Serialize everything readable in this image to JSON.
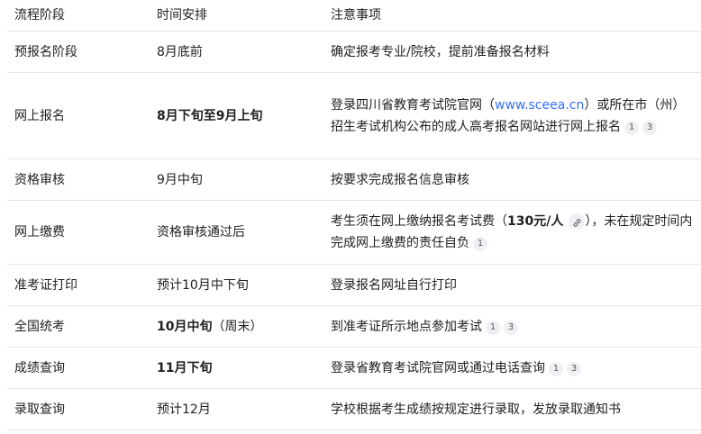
{
  "headers": [
    "流程阶段",
    "时间安排",
    "注意事项"
  ],
  "rows": [
    {
      "stage": "预报名阶段",
      "time": "8月底前",
      "note": "确定报考专业/院校，提前准备报名材料"
    },
    {
      "stage": "网上报名",
      "time": "8月下旬至9月上旬",
      "note_pre": "登录四川省教育考试院官网（",
      "note_link": "www.sceea.cn",
      "note_post": "）或所在市（州）招生考试机构公布的成人高考报名网站进行网上报名",
      "refs": [
        "1",
        "3"
      ]
    },
    {
      "stage": "资格审核",
      "time": "9月中旬",
      "note": "按要求完成报名信息审核"
    },
    {
      "stage": "网上缴费",
      "time": "资格审核通过后",
      "note_pre": "考生须在网上缴纳报名考试费（",
      "note_bold": "130元/人",
      "note_post": "），未在规定时间内完成网上缴费的责任自负",
      "refs": [
        "1"
      ]
    },
    {
      "stage": "准考证打印",
      "time": "预计10月中下旬",
      "note": "登录报名网址自行打印"
    },
    {
      "stage": "全国统考",
      "time_bold": "10月中旬",
      "time_rest": "（周末）",
      "note": "到准考证所示地点参加考试",
      "refs": [
        "1",
        "3"
      ]
    },
    {
      "stage": "成绩查询",
      "time": "11月下旬",
      "note": "登录省教育考试院官网或通过电话查询",
      "refs": [
        "1",
        "3"
      ]
    },
    {
      "stage": "录取查询",
      "time": "预计12月",
      "note": "学校根据考生成绩按规定进行录取，发放录取通知书"
    }
  ]
}
